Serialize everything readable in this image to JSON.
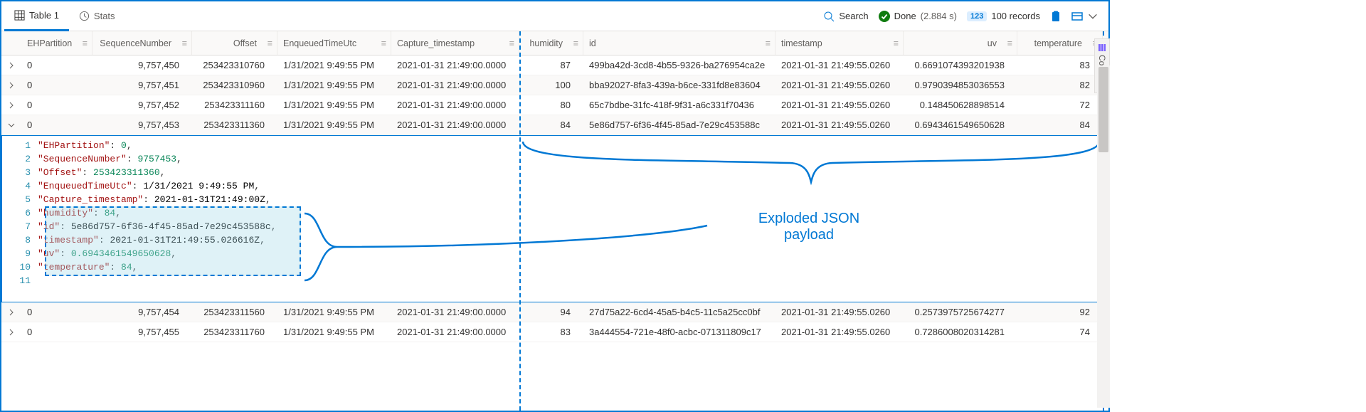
{
  "tabs": {
    "table": "Table 1",
    "stats": "Stats"
  },
  "toolbar": {
    "search": "Search",
    "done_label": "Done",
    "done_time": "(2.884 s)",
    "records_badge": "123",
    "records_label": "100 records"
  },
  "columns": {
    "eh": "EHPartition",
    "seq": "SequenceNumber",
    "off": "Offset",
    "enq": "EnqueuedTimeUtc",
    "cap": "Capture_timestamp",
    "hum": "humidity",
    "id": "id",
    "ts": "timestamp",
    "uv": "uv",
    "temp": "temperature"
  },
  "side_tab": "Columns",
  "rows": [
    {
      "eh": "0",
      "seq": "9,757,450",
      "off": "253423310760",
      "enq": "1/31/2021 9:49:55 PM",
      "cap": "2021-01-31 21:49:00.0000",
      "hum": "87",
      "id": "499ba42d-3cd8-4b55-9326-ba276954ca2e",
      "ts": "2021-01-31 21:49:55.0260",
      "uv": "0.6691074393201938",
      "temp": "83"
    },
    {
      "eh": "0",
      "seq": "9,757,451",
      "off": "253423310960",
      "enq": "1/31/2021 9:49:55 PM",
      "cap": "2021-01-31 21:49:00.0000",
      "hum": "100",
      "id": "bba92027-8fa3-439a-b6ce-331fd8e83604",
      "ts": "2021-01-31 21:49:55.0260",
      "uv": "0.9790394853036553",
      "temp": "82"
    },
    {
      "eh": "0",
      "seq": "9,757,452",
      "off": "253423311160",
      "enq": "1/31/2021 9:49:55 PM",
      "cap": "2021-01-31 21:49:00.0000",
      "hum": "80",
      "id": "65c7bdbe-31fc-418f-9f31-a6c331f70436",
      "ts": "2021-01-31 21:49:55.0260",
      "uv": "0.148450628898514",
      "temp": "72"
    },
    {
      "eh": "0",
      "seq": "9,757,453",
      "off": "253423311360",
      "enq": "1/31/2021 9:49:55 PM",
      "cap": "2021-01-31 21:49:00.0000",
      "hum": "84",
      "id": "5e86d757-6f36-4f45-85ad-7e29c453588c",
      "ts": "2021-01-31 21:49:55.0260",
      "uv": "0.6943461549650628",
      "temp": "84",
      "expanded": true
    },
    {
      "eh": "0",
      "seq": "9,757,454",
      "off": "253423311560",
      "enq": "1/31/2021 9:49:55 PM",
      "cap": "2021-01-31 21:49:00.0000",
      "hum": "94",
      "id": "27d75a22-6cd4-45a5-b4c5-11c5a25cc0bf",
      "ts": "2021-01-31 21:49:55.0260",
      "uv": "0.2573975725674277",
      "temp": "92"
    },
    {
      "eh": "0",
      "seq": "9,757,455",
      "off": "253423311760",
      "enq": "1/31/2021 9:49:55 PM",
      "cap": "2021-01-31 21:49:00.0000",
      "hum": "83",
      "id": "3a444554-721e-48f0-acbc-071311809c17",
      "ts": "2021-01-31 21:49:55.0260",
      "uv": "0.7286008020314281",
      "temp": "74"
    }
  ],
  "detail_lines": [
    {
      "n": "1",
      "key": "\"EHPartition\"",
      "val": "0",
      "type": "num"
    },
    {
      "n": "2",
      "key": "\"SequenceNumber\"",
      "val": "9757453",
      "type": "num"
    },
    {
      "n": "3",
      "key": "\"Offset\"",
      "val": "253423311360",
      "type": "num"
    },
    {
      "n": "4",
      "key": "\"EnqueuedTimeUtc\"",
      "val": "1/31/2021 9:49:55 PM",
      "type": "str"
    },
    {
      "n": "5",
      "key": "\"Capture_timestamp\"",
      "val": "2021-01-31T21:49:00Z",
      "type": "str"
    },
    {
      "n": "6",
      "key": "\"humidity\"",
      "val": "84",
      "type": "num"
    },
    {
      "n": "7",
      "key": "\"id\"",
      "val": "5e86d757-6f36-4f45-85ad-7e29c453588c",
      "type": "str"
    },
    {
      "n": "8",
      "key": "\"timestamp\"",
      "val": "2021-01-31T21:49:55.026616Z",
      "type": "str"
    },
    {
      "n": "9",
      "key": "\"uv\"",
      "val": "0.6943461549650628",
      "type": "num"
    },
    {
      "n": "10",
      "key": "\"temperature\"",
      "val": "84",
      "type": "num"
    },
    {
      "n": "11",
      "key": "",
      "val": "",
      "type": "empty"
    }
  ],
  "annotation": {
    "label1": "Exploded JSON",
    "label2": "payload"
  }
}
